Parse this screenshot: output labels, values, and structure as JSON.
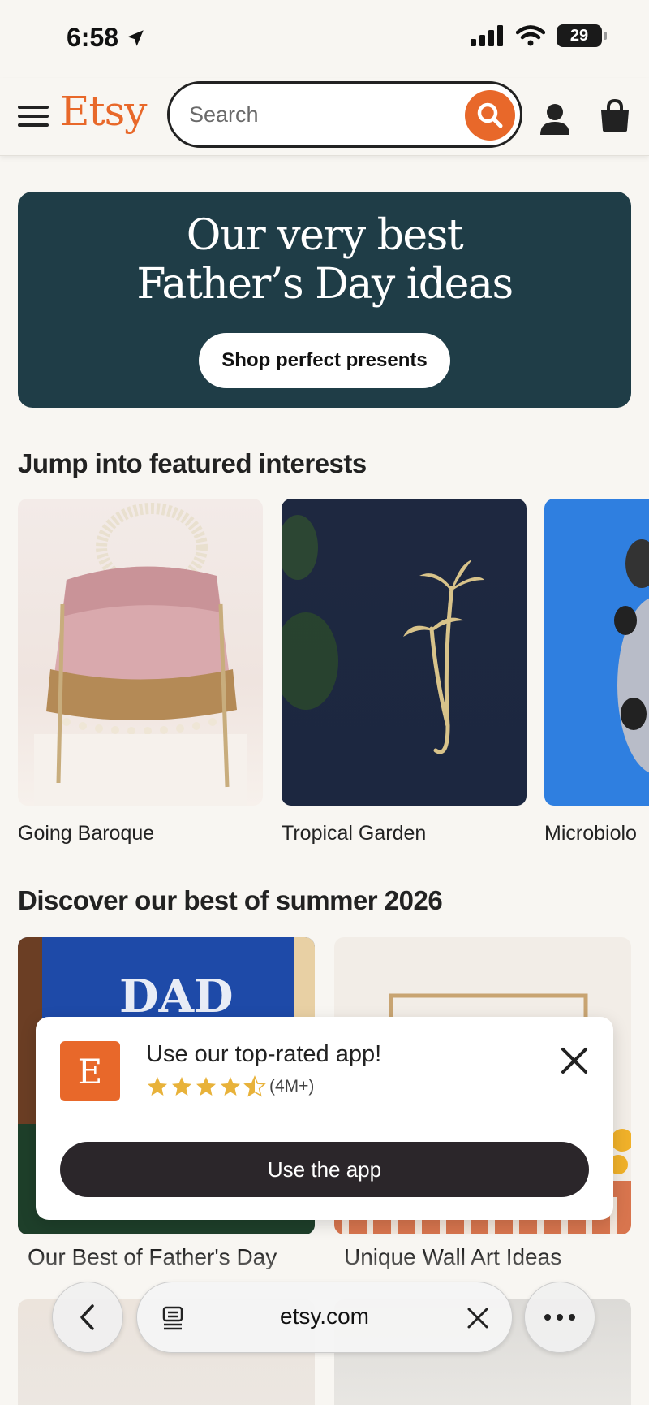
{
  "status_bar": {
    "time": "6:58",
    "battery": "29"
  },
  "header": {
    "logo": "Etsy",
    "search_placeholder": "Search"
  },
  "hero": {
    "title_line1": "Our very best",
    "title_line2": "Father’s Day ideas",
    "button": "Shop perfect presents"
  },
  "featured": {
    "title": "Jump into featured interests",
    "items": [
      {
        "label": "Going Baroque"
      },
      {
        "label": "Tropical Garden"
      },
      {
        "label": "Microbiolo"
      }
    ]
  },
  "summer": {
    "title": "Discover our best of summer 2026",
    "items": [
      {
        "label": "Our Best of Father's Day",
        "image_text": "DAD"
      },
      {
        "label": "Unique Wall Art Ideas"
      }
    ]
  },
  "app_promo": {
    "logo_letter": "E",
    "title": "Use our top-rated app!",
    "rating": 4.5,
    "rating_count": "(4M+)",
    "button": "Use the app"
  },
  "browser": {
    "url": "etsy.com"
  },
  "colors": {
    "brand": "#e8682a",
    "hero_bg": "#1f3d47",
    "dark_button": "#2b262a"
  }
}
